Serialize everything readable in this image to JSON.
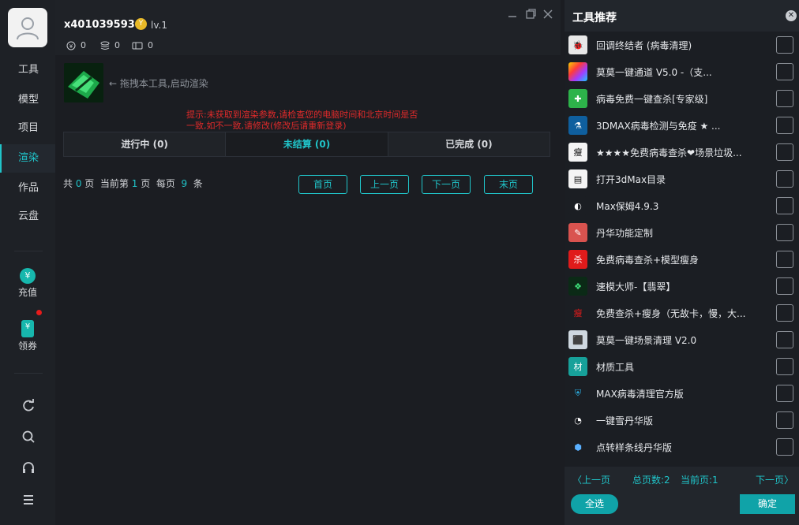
{
  "user": {
    "name": "x401039593",
    "vip_symbol": "Y",
    "level": "lv.1",
    "coins": "0",
    "points": "0",
    "tickets": "0"
  },
  "nav": {
    "items": [
      {
        "label": "工具"
      },
      {
        "label": "模型"
      },
      {
        "label": "项目"
      },
      {
        "label": "渲染"
      },
      {
        "label": "作品"
      },
      {
        "label": "云盘"
      }
    ],
    "active": "渲染",
    "recharge_label": "充值",
    "recharge_symbol": "¥",
    "coupon_label": "领券",
    "coupon_symbol": "¥",
    "bottom_icons": [
      "refresh-icon",
      "search-icon",
      "headset-icon",
      "menu-icon"
    ]
  },
  "main": {
    "drag_hint": "拖拽本工具,启动渲染",
    "warning": "提示:未获取到渲染参数,请检查您的电脑时间和北京时间是否一致,如不一致,请修改(修改后请重新登录)",
    "tabs": [
      {
        "label": "进行中 (0)"
      },
      {
        "label": "未结算 (0)"
      },
      {
        "label": "已完成 (0)"
      }
    ],
    "active_tab": 1,
    "pager": {
      "t1": "共 ",
      "total": "0",
      "t2": " 页  当前第 ",
      "current": "1",
      "t3": " 页  每页  ",
      "per_page": "9",
      "t4": "  条",
      "first": "首页",
      "prev": "上一页",
      "next": "下一页",
      "last": "末页"
    }
  },
  "panel": {
    "title": "工具推荐",
    "items": [
      {
        "label": "回调终结者 (病毒清理)",
        "icon": "bug-icon",
        "color": "#e8e8e8",
        "glyph": "🐞"
      },
      {
        "label": "莫莫一键通道 V5.0 -（支...",
        "icon": "colorful-grid-icon",
        "color": "#f2c200",
        "glyph": ""
      },
      {
        "label": "病毒免费一键查杀[专家级]",
        "icon": "virus-scan-icon",
        "color": "#2db34a",
        "glyph": "✚"
      },
      {
        "label": "3DMAX病毒检测与免疫 ★ ...",
        "icon": "test-tube-icon",
        "color": "#0f5f9e",
        "glyph": "⚗"
      },
      {
        "label": "★★★★免费病毒查杀❤场景垃圾...",
        "icon": "calligraphy-icon",
        "color": "#f4f4f4",
        "glyph": "瘦"
      },
      {
        "label": "打开3dMax目录",
        "icon": "document-icon",
        "color": "#f4f4f4",
        "glyph": "▤"
      },
      {
        "label": "Max保姆4.9.3",
        "icon": "mask-icon",
        "color": "#1b1e23",
        "glyph": "◐"
      },
      {
        "label": "丹华功能定制",
        "icon": "toolbox-icon",
        "color": "#d9534f",
        "glyph": "✎"
      },
      {
        "label": "免费病毒查杀+模型瘦身",
        "icon": "kill-icon",
        "color": "#e01b1b",
        "glyph": "杀"
      },
      {
        "label": "速模大师-【翡翠】",
        "icon": "jade-icon",
        "color": "#0b2a16",
        "glyph": "❖"
      },
      {
        "label": "免费查杀+瘦身（无故卡，慢，大...",
        "icon": "red-text-icon",
        "color": "#1b1e23",
        "glyph": "瘦"
      },
      {
        "label": "莫莫一键场景清理 V2.0",
        "icon": "cleaner-robot-icon",
        "color": "#cfd8e0",
        "glyph": "⬛"
      },
      {
        "label": "材质工具",
        "icon": "material-icon",
        "color": "#17a19a",
        "glyph": "材"
      },
      {
        "label": "MAX病毒清理官方版",
        "icon": "shield-icon",
        "color": "#1b1e23",
        "glyph": "⛨"
      },
      {
        "label": "一键雪丹华版",
        "icon": "snow-bird-icon",
        "color": "#1b1e23",
        "glyph": "◔"
      },
      {
        "label": "点转样条线丹华版",
        "icon": "cube-icon",
        "color": "#1b1e23",
        "glyph": "⬢"
      }
    ],
    "prev": "〈上一页",
    "total_pages": "总页数:2",
    "current_page": "当前页:1",
    "next": "下一页〉",
    "select_all": "全选",
    "confirm": "确定"
  }
}
